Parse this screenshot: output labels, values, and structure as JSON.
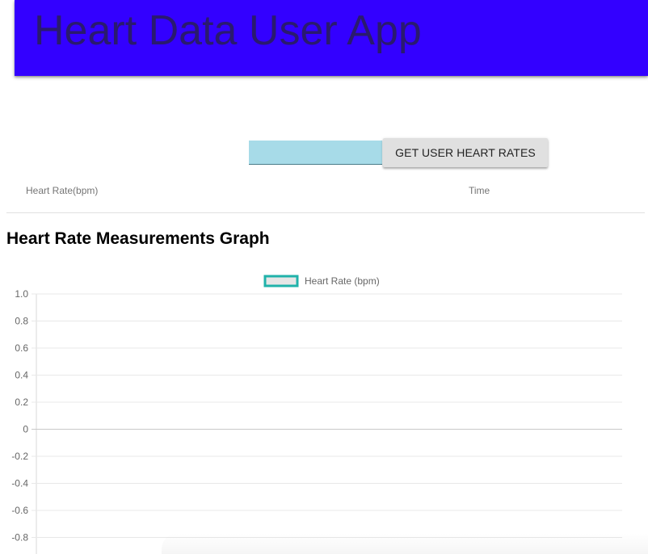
{
  "header": {
    "title": "Heart Data User App",
    "bar_color": "#3300ff"
  },
  "controls": {
    "user_input_value": "",
    "user_input_placeholder": "",
    "get_button_label": "GET USER HEART RATES"
  },
  "table": {
    "columns": [
      "Heart Rate(bpm)",
      "Time"
    ],
    "rows": []
  },
  "graph": {
    "title": "Heart Rate Measurements Graph"
  },
  "chart_data": {
    "type": "line",
    "title": "",
    "xlabel": "",
    "ylabel": "",
    "x": [],
    "series": [
      {
        "name": "Heart Rate (bpm)",
        "values": [],
        "border_color": "#20b2aa",
        "fill_color": "#e6e6e6"
      }
    ],
    "ylim": [
      -1.0,
      1.0
    ],
    "y_ticks": [
      "1.0",
      "0.8",
      "0.6",
      "0.4",
      "0.2",
      "0",
      "-0.2",
      "-0.4",
      "-0.6",
      "-0.8"
    ],
    "legend_position": "top",
    "grid": true
  }
}
